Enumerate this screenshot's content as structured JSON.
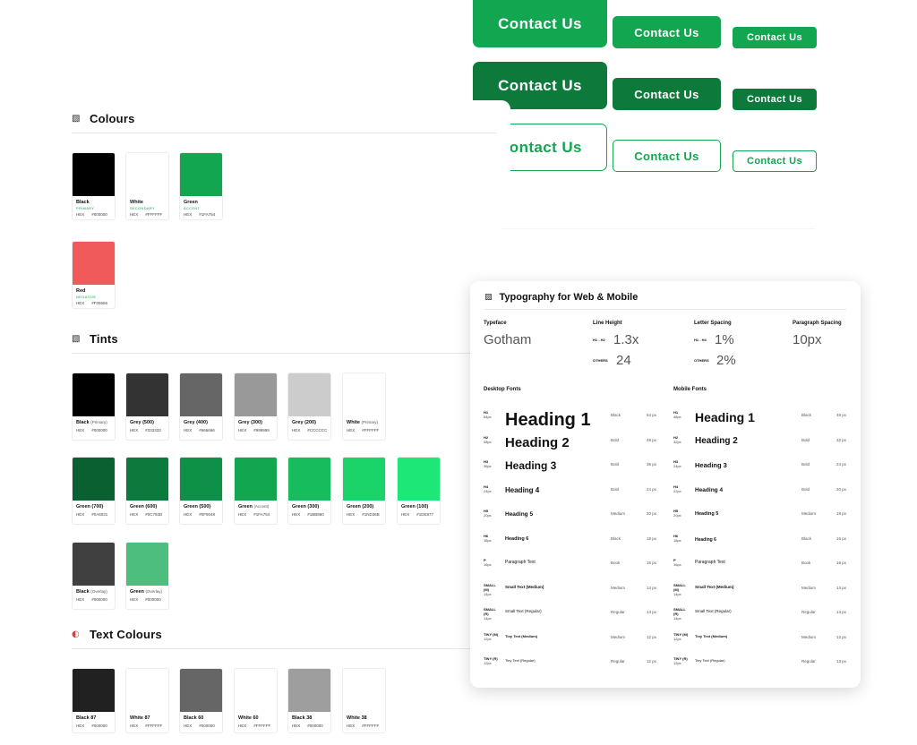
{
  "buttons": {
    "label": "Contact Us",
    "colors": {
      "primary": "#13A651",
      "dark": "#0D7A3C",
      "outline_bg": "#FFFFFF"
    }
  },
  "colours": {
    "title": "Colours",
    "swatches": [
      {
        "name": "Black",
        "role": "PRIMARY",
        "hex_label": "HEX",
        "hex": "#000000",
        "color": "#000000"
      },
      {
        "name": "White",
        "role": "SECONDARY",
        "hex_label": "HEX",
        "hex": "#FFFFFF",
        "color": "#FFFFFF"
      },
      {
        "name": "Green",
        "role": "ACCENT",
        "hex_label": "HEX",
        "hex": "#1FA754",
        "color": "#13A651"
      },
      {
        "name": "Red",
        "role": "NEGATIVE",
        "hex_label": "HEX",
        "hex": "#F05656",
        "color": "#F05A5A"
      }
    ]
  },
  "tints": {
    "title": "Tints",
    "swatches": [
      {
        "name": "Black",
        "sub": "(Primary)",
        "hex_label": "HEX",
        "hex": "#000000",
        "color": "#000000"
      },
      {
        "name": "Grey (500)",
        "sub": "",
        "hex_label": "HEX",
        "hex": "#333333",
        "color": "#333333"
      },
      {
        "name": "Grey (400)",
        "sub": "",
        "hex_label": "HEX",
        "hex": "#666666",
        "color": "#666666"
      },
      {
        "name": "Grey (300)",
        "sub": "",
        "hex_label": "HEX",
        "hex": "#999999",
        "color": "#999999"
      },
      {
        "name": "Grey (200)",
        "sub": "",
        "hex_label": "HEX",
        "hex": "#CCCCCC",
        "color": "#CCCCCC"
      },
      {
        "name": "White",
        "sub": "(Primary)",
        "hex_label": "HEX",
        "hex": "#FFFFFF",
        "color": "#FFFFFF"
      },
      {
        "name": "Green (700)",
        "sub": "",
        "hex_label": "HEX",
        "hex": "#0A6031",
        "color": "#0A6031"
      },
      {
        "name": "Green (600)",
        "sub": "",
        "hex_label": "HEX",
        "hex": "#0C793D",
        "color": "#0C793D"
      },
      {
        "name": "Green (500)",
        "sub": "",
        "hex_label": "HEX",
        "hex": "#0F9048",
        "color": "#0F9048"
      },
      {
        "name": "Green",
        "sub": "(Accent)",
        "hex_label": "HEX",
        "hex": "#1FA754",
        "color": "#13A651"
      },
      {
        "name": "Green (300)",
        "sub": "",
        "hex_label": "HEX",
        "hex": "#1BB860",
        "color": "#17BD5C"
      },
      {
        "name": "Green (200)",
        "sub": "",
        "hex_label": "HEX",
        "hex": "#1ND36B",
        "color": "#1AD469"
      },
      {
        "name": "Green (100)",
        "sub": "",
        "hex_label": "HEX",
        "hex": "#1DE877",
        "color": "#1DE877"
      },
      {
        "name": "Black",
        "sub": "(Overlay)",
        "hex_label": "HEX",
        "hex": "#000000",
        "color": "#404040"
      },
      {
        "name": "Green",
        "sub": "(Overlay)",
        "hex_label": "HEX",
        "hex": "#000000",
        "color": "#4DBE7E"
      }
    ]
  },
  "text_colours": {
    "title": "Text Colours",
    "swatches": [
      {
        "name": "Black 87",
        "hex_label": "HEX",
        "hex": "#000000",
        "color": "#212121"
      },
      {
        "name": "White 87",
        "hex_label": "HEX",
        "hex": "#FFFFFF",
        "color": "#FFFFFF"
      },
      {
        "name": "Black 60",
        "hex_label": "HEX",
        "hex": "#000000",
        "color": "#666666"
      },
      {
        "name": "White 60",
        "hex_label": "HEX",
        "hex": "#FFFFFF",
        "color": "#FFFFFF"
      },
      {
        "name": "Black 38",
        "hex_label": "HEX",
        "hex": "#000000",
        "color": "#9E9E9E"
      },
      {
        "name": "White 38",
        "hex_label": "HEX",
        "hex": "#FFFFFF",
        "color": "#FFFFFF"
      }
    ]
  },
  "typography": {
    "title": "Typography for Web & Mobile",
    "typeface_label": "Typeface",
    "typeface": "Gotham",
    "line_height_label": "Line Height",
    "lh_h1h2_label": "H1 - H2",
    "lh_h1h2": "1.3x",
    "lh_others_label": "OTHERS",
    "lh_others": "24",
    "letter_spacing_label": "Letter Spacing",
    "ls_h1h4_label": "H1 - H4",
    "ls_h1h4": "1%",
    "ls_others_label": "OTHERS",
    "ls_others": "2%",
    "paragraph_spacing_label": "Paragraph Spacing",
    "paragraph_spacing": "10px",
    "desktop_label": "Desktop Fonts",
    "mobile_label": "Mobile Fonts",
    "desktop_rows": [
      {
        "tag": "H1",
        "px": "64px",
        "sample": "Heading 1",
        "weight": "Black",
        "size": "64 px"
      },
      {
        "tag": "H2",
        "px": "48px",
        "sample": "Heading 2",
        "weight": "Bold",
        "size": "48 px"
      },
      {
        "tag": "H3",
        "px": "36px",
        "sample": "Heading 3",
        "weight": "Bold",
        "size": "36 px"
      },
      {
        "tag": "H4",
        "px": "24px",
        "sample": "Heading 4",
        "weight": "Bold",
        "size": "24 px"
      },
      {
        "tag": "H5",
        "px": "20px",
        "sample": "Heading 5",
        "weight": "Medium",
        "size": "20 px"
      },
      {
        "tag": "H6",
        "px": "18px",
        "sample": "Heading 6",
        "weight": "Black",
        "size": "18 px"
      },
      {
        "tag": "P",
        "px": "16px",
        "sample": "Paragraph Text",
        "weight": "Book",
        "size": "16 px"
      },
      {
        "tag": "SMALL (M)",
        "px": "14px",
        "sample": "Small Text (Medium)",
        "weight": "Medium",
        "size": "14 px"
      },
      {
        "tag": "SMALL (R)",
        "px": "14px",
        "sample": "Small Text (Regular)",
        "weight": "Regular",
        "size": "14 px"
      },
      {
        "tag": "TINY (M)",
        "px": "12px",
        "sample": "Tiny Text (Medium)",
        "weight": "Medium",
        "size": "12 px"
      },
      {
        "tag": "TINY (R)",
        "px": "12px",
        "sample": "Tiny Text (Regular)",
        "weight": "Regular",
        "size": "12 px"
      }
    ],
    "mobile_rows": [
      {
        "tag": "H1",
        "px": "48px",
        "sample": "Heading 1",
        "weight": "Black",
        "size": "48 px"
      },
      {
        "tag": "H2",
        "px": "32px",
        "sample": "Heading 2",
        "weight": "Bold",
        "size": "32 px"
      },
      {
        "tag": "H3",
        "px": "24px",
        "sample": "Heading 3",
        "weight": "Bold",
        "size": "24 px"
      },
      {
        "tag": "H4",
        "px": "22px",
        "sample": "Heading 4",
        "weight": "Bold",
        "size": "20 px"
      },
      {
        "tag": "H5",
        "px": "20px",
        "sample": "Heading 5",
        "weight": "Medium",
        "size": "18 px"
      },
      {
        "tag": "H6",
        "px": "18px",
        "sample": "Heading 6",
        "weight": "Black",
        "size": "16 px"
      },
      {
        "tag": "P",
        "px": "16px",
        "sample": "Paragraph Text",
        "weight": "Book",
        "size": "16 px"
      },
      {
        "tag": "SMALL (M)",
        "px": "14px",
        "sample": "Small Text (Medium)",
        "weight": "Medium",
        "size": "14 px"
      },
      {
        "tag": "SMALL (R)",
        "px": "14px",
        "sample": "Small Text (Regular)",
        "weight": "Regular",
        "size": "14 px"
      },
      {
        "tag": "TINY (M)",
        "px": "12px",
        "sample": "Tiny Text (Medium)",
        "weight": "Medium",
        "size": "12 px"
      },
      {
        "tag": "TINY (R)",
        "px": "12px",
        "sample": "Tiny Text (Regular)",
        "weight": "Regular",
        "size": "13 px"
      }
    ]
  }
}
